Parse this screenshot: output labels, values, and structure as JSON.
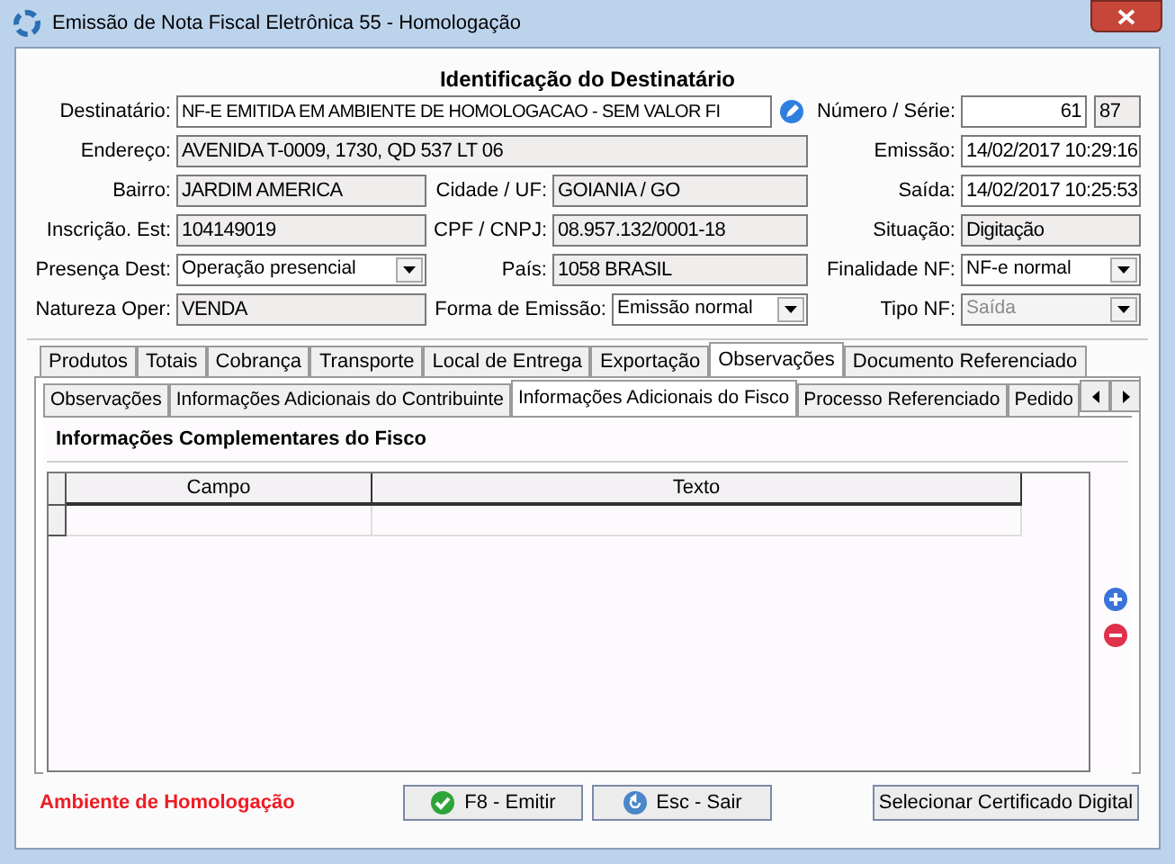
{
  "window": {
    "title": "Emissão de Nota Fiscal Eletrônica 55 - Homologação"
  },
  "form": {
    "title": "Identificação do Destinatário",
    "rows": [
      [
        {
          "label": "Destinatário:",
          "value": "NF-E EMITIDA EM AMBIENTE DE HOMOLOGACAO - SEM VALOR FI",
          "kind": "text",
          "readonly": false
        },
        {
          "label": "Número / Série:",
          "value": "61",
          "kind": "number",
          "readonly": false
        },
        {
          "value": "87",
          "kind": "text",
          "readonly": true
        }
      ],
      [
        {
          "label": "Endereço:",
          "value": "AVENIDA T-0009, 1730, QD 537 LT 06",
          "kind": "text",
          "readonly": true
        },
        {
          "label": "Emissão:",
          "value": "14/02/2017 10:29:16",
          "kind": "text",
          "readonly": false
        }
      ],
      [
        {
          "label": "Bairro:",
          "value": "JARDIM AMERICA",
          "kind": "text",
          "readonly": true
        },
        {
          "label": "Cidade / UF:",
          "value": "GOIANIA / GO",
          "kind": "text",
          "readonly": true
        },
        {
          "label": "Saída:",
          "value": "14/02/2017 10:25:53",
          "kind": "text",
          "readonly": false
        }
      ],
      [
        {
          "label": "Inscrição. Est:",
          "value": "104149019",
          "kind": "text",
          "readonly": true
        },
        {
          "label": "CPF / CNPJ:",
          "value": "08.957.132/0001-18",
          "kind": "text",
          "readonly": true
        },
        {
          "label": "Situação:",
          "value": "Digitação",
          "kind": "text",
          "readonly": true
        }
      ],
      [
        {
          "label": "Presença Dest:",
          "value": "Operação presencial",
          "kind": "dropdown",
          "disabled": false
        },
        {
          "label": "País:",
          "value": "1058 BRASIL",
          "kind": "text",
          "readonly": true
        },
        {
          "label": "Finalidade NF:",
          "value": "NF-e normal",
          "kind": "dropdown",
          "disabled": false
        }
      ],
      [
        {
          "label": "Natureza Oper:",
          "value": "VENDA",
          "kind": "text",
          "readonly": true
        },
        {
          "label": "Forma de Emissão:",
          "value": "Emissão normal",
          "kind": "dropdown",
          "disabled": false
        },
        {
          "label": "Tipo NF:",
          "value": "Saída",
          "kind": "dropdown",
          "disabled": true
        }
      ]
    ]
  },
  "tabs": [
    {
      "label": "Produtos",
      "selected": false
    },
    {
      "label": "Totais",
      "selected": false
    },
    {
      "label": "Cobrança",
      "selected": false
    },
    {
      "label": "Transporte",
      "selected": false
    },
    {
      "label": "Local de Entrega",
      "selected": false
    },
    {
      "label": "Exportação",
      "selected": false
    },
    {
      "label": "Observações",
      "selected": true
    },
    {
      "label": "Documento Referenciado",
      "selected": false
    }
  ],
  "subtabs": [
    {
      "label": "Observações",
      "selected": false
    },
    {
      "label": "Informações Adicionais do Contribuinte",
      "selected": false
    },
    {
      "label": "Informações Adicionais do Fisco",
      "selected": true
    },
    {
      "label": "Processo Referenciado",
      "selected": false
    },
    {
      "label": "Pedido",
      "selected": false
    }
  ],
  "panel": {
    "title": "Informações Complementares do Fisco",
    "table": {
      "columns": [
        "Campo",
        "Texto"
      ]
    }
  },
  "footer": {
    "environment": "Ambiente de Homologação",
    "buttons": [
      "F8 - Emitir",
      "Esc - Sair",
      "Selecionar Certificado Digital"
    ]
  }
}
